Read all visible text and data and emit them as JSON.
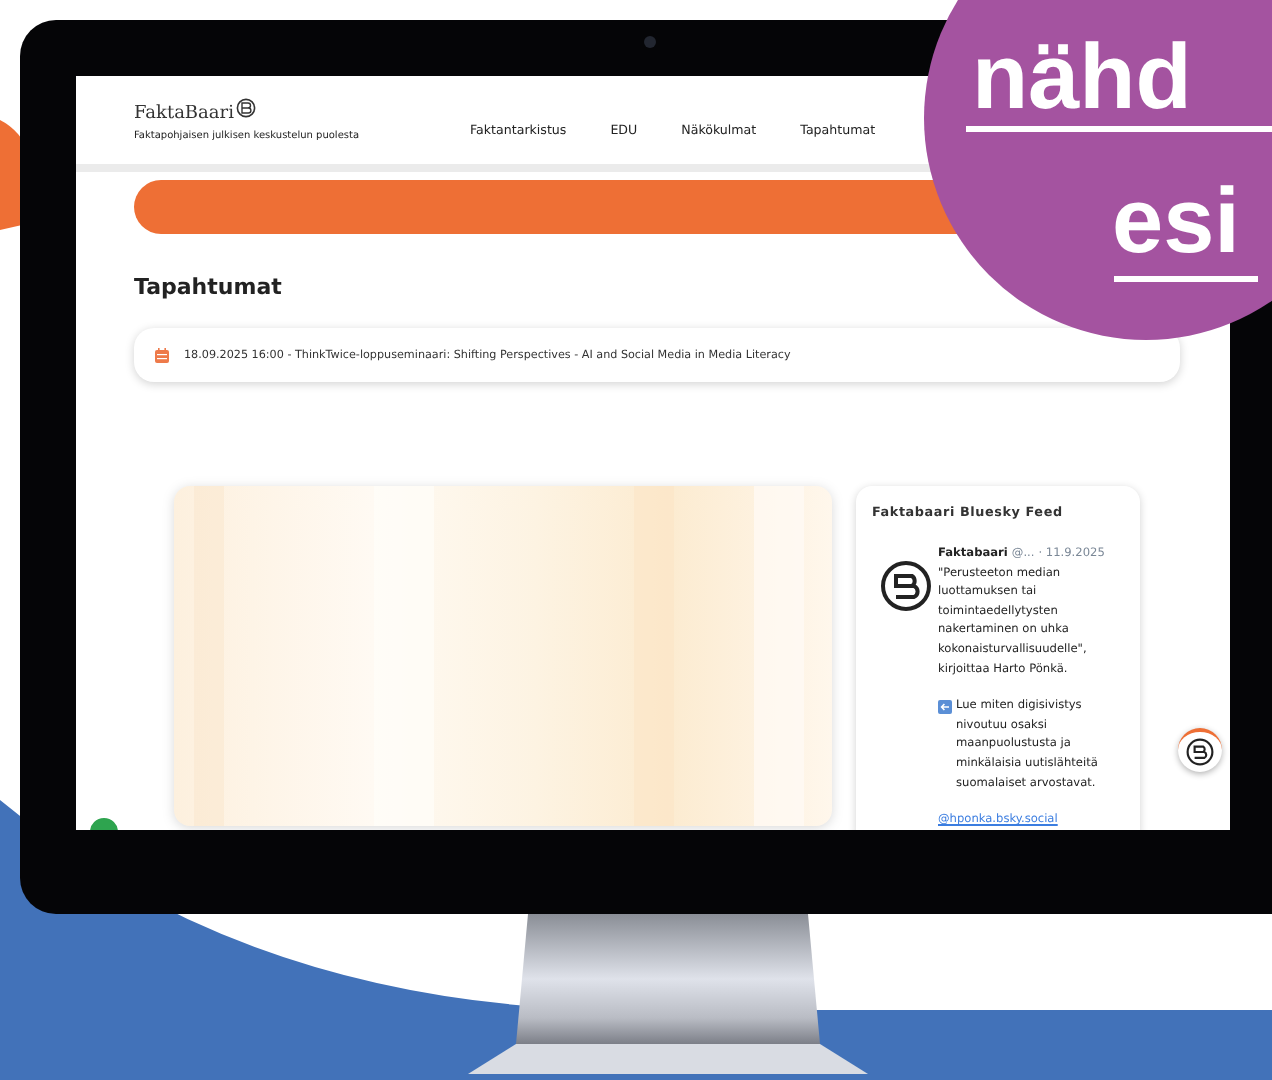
{
  "header": {
    "logo": "FaktaBaari",
    "tagline": "Faktapohjaisen julkisen keskustelun puolesta",
    "nav": [
      {
        "label": "Faktantarkistus"
      },
      {
        "label": "EDU"
      },
      {
        "label": "Näkökulmat"
      },
      {
        "label": "Tapahtumat"
      }
    ]
  },
  "heading": "Tapahtumat",
  "events": [
    {
      "text": "18.09.2025 16:00 - ThinkTwice-loppuseminaari: Shifting Perspectives - AI and Social Media in Media Literacy"
    }
  ],
  "feed": {
    "title": "Faktabaari Bluesky Feed",
    "posts": [
      {
        "author": "Faktabaari",
        "handle": "@...",
        "date": "· 11.9.2025",
        "paragraphs": [
          "\"Perusteeton median luottamuksen tai toimintaedellytysten nakertaminen on uhka kokonaisturvallisuudelle\", kirjoittaa Harto Pönkä.",
          "Lue miten digisivistys nivoutuu osaksi maanpuolustusta ja minkälaisia uutislähteitä suomalaiset arvostavat."
        ],
        "link": "@hponka.bsky.social"
      }
    ]
  },
  "overlay": {
    "lines": [
      "nähd",
      "esi"
    ]
  }
}
